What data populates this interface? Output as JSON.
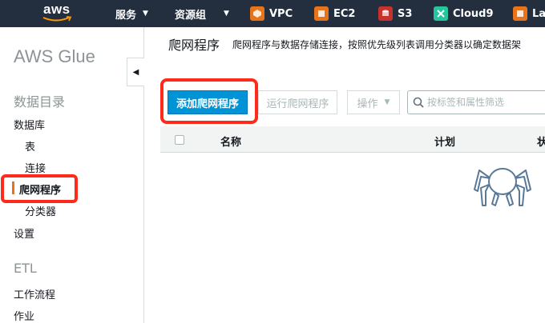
{
  "topnav": {
    "logo_text": "aws",
    "menus": [
      {
        "label": "服务"
      },
      {
        "label": "资源组"
      }
    ],
    "services": [
      {
        "label": "VPC",
        "icon": "vpc-icon",
        "color": "#e7731a"
      },
      {
        "label": "EC2",
        "icon": "ec2-icon",
        "color": "#e7731a"
      },
      {
        "label": "S3",
        "icon": "s3-icon",
        "color": "#c7332c"
      },
      {
        "label": "Cloud9",
        "icon": "cloud9-icon",
        "color": "#25c69e"
      },
      {
        "label": "La",
        "icon": "lambda-icon",
        "color": "#e7731a"
      }
    ]
  },
  "sidebar": {
    "title": "AWS Glue",
    "section_catalog": "数据目录",
    "items": [
      {
        "label": "数据库"
      },
      {
        "label": "表"
      },
      {
        "label": "连接"
      },
      {
        "label": "爬网程序"
      },
      {
        "label": "分类器"
      },
      {
        "label": "设置"
      }
    ],
    "section_etl": "ETL",
    "etl_items": [
      {
        "label": "工作流程"
      },
      {
        "label": "作业"
      }
    ]
  },
  "main": {
    "title": "爬网程序",
    "description": "爬网程序与数据存储连接，按照优先级列表调用分类器以确定数据架",
    "add_button": "添加爬网程序",
    "run_button": "运行爬网程序",
    "actions_button": "操作",
    "search_placeholder": "按标签和属性筛选",
    "columns": [
      "名称",
      "计划",
      "状"
    ]
  },
  "colors": {
    "nav_bg": "#232f3e",
    "primary_button": "#0094d6",
    "highlight_box": "#ff2a1a",
    "active_indicator": "#ec7211"
  }
}
